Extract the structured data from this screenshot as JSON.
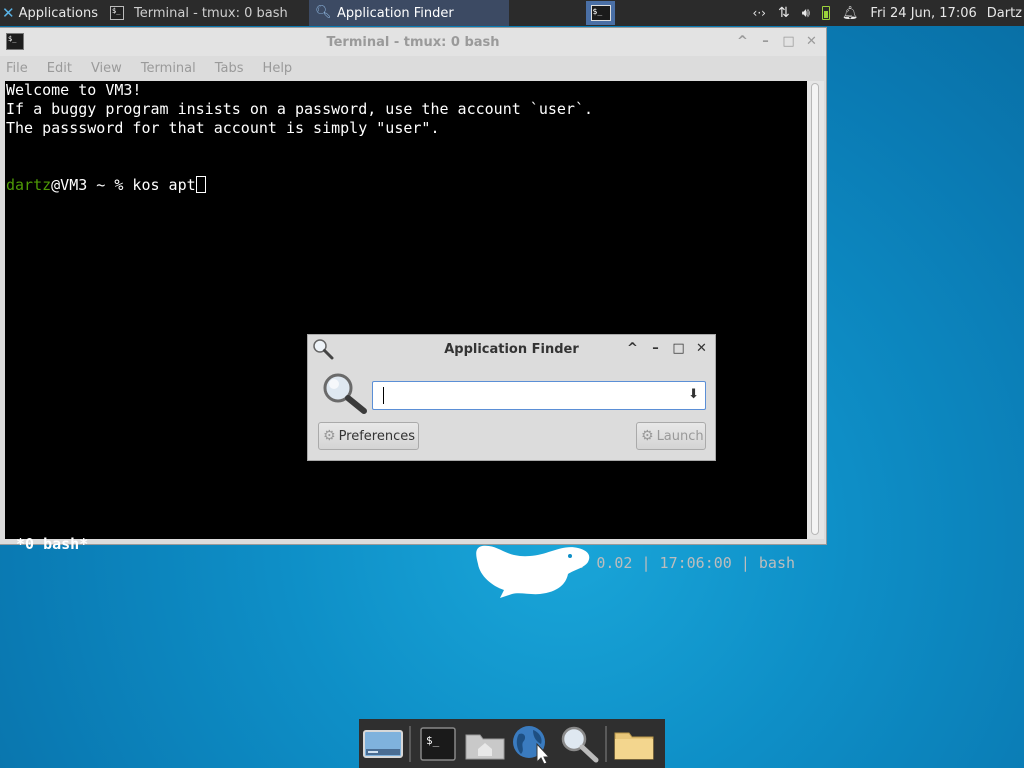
{
  "top_panel": {
    "apps_label": "Applications",
    "tasks": [
      {
        "label": "Terminal - tmux: 0 bash"
      },
      {
        "label": "Application Finder"
      }
    ],
    "network_icon": "network-arrows-icon",
    "transfer_icon": "up-down-arrows-icon",
    "volume_icon": "speaker-icon",
    "battery_icon": "battery-icon",
    "notification_icon": "bell-icon",
    "clock": "Fri 24 Jun, 17:06",
    "user": "Dartz"
  },
  "terminal": {
    "title": "Terminal - tmux: 0 bash",
    "menu": [
      "File",
      "Edit",
      "View",
      "Terminal",
      "Tabs",
      "Help"
    ],
    "lines": [
      "Welcome to VM3!",
      "If a buggy program insists on a password, use the account `user`.",
      "The passsword for that account is simply \"user\"."
    ],
    "prompt_user": "dartz",
    "prompt_rest": "@VM3 ~ % kos apt",
    "status_left": "*0 bash*",
    "status_right": "0.10 0.07 0.02 | 17:06:00 | bash"
  },
  "finder": {
    "title": "Application Finder",
    "search_value": "",
    "preferences_label": "Preferences",
    "launch_label": "Launch"
  },
  "dock": {
    "items": [
      "show-desktop",
      "terminal",
      "home-folder",
      "web-browser",
      "app-finder",
      "files"
    ]
  },
  "colors": {
    "panel_bg": "#2b2b2b",
    "active_task_bg": "#3c4a63",
    "prompt_user": "#4e9a06",
    "desktop": "#0e8fc7"
  }
}
